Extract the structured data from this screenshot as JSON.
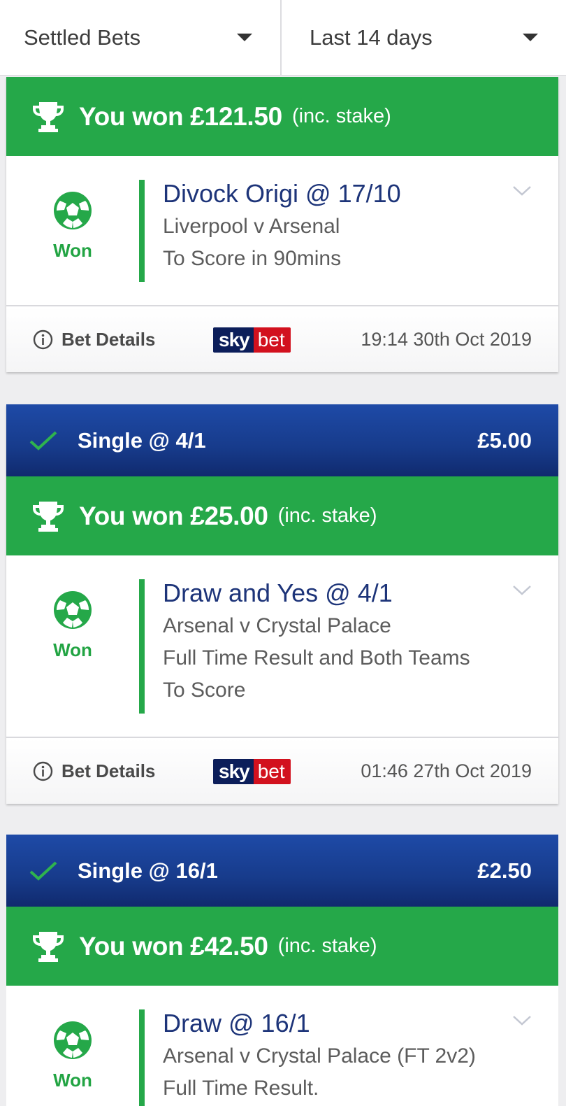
{
  "filters": {
    "status": "Settled Bets",
    "period": "Last 14 days"
  },
  "cards": [
    {
      "bet_type": "",
      "stake": "",
      "win_amount": "You won £121.50",
      "win_note": "(inc. stake)",
      "status": "Won",
      "selection": "Divock Origi @ 17/10",
      "event": "Liverpool v Arsenal",
      "market_lines": [
        "To Score in 90mins"
      ],
      "details_label": "Bet Details",
      "logo_sky": "sky",
      "logo_bet": "bet",
      "timestamp": "19:14 30th Oct 2019"
    },
    {
      "bet_type": "Single @ 4/1",
      "stake": "£5.00",
      "win_amount": "You won £25.00",
      "win_note": "(inc. stake)",
      "status": "Won",
      "selection": "Draw and Yes @ 4/1",
      "event": "Arsenal v Crystal Palace",
      "market_lines": [
        "Full Time Result and Both Teams",
        "To Score"
      ],
      "details_label": "Bet Details",
      "logo_sky": "sky",
      "logo_bet": "bet",
      "timestamp": "01:46 27th Oct 2019"
    },
    {
      "bet_type": "Single @ 16/1",
      "stake": "£2.50",
      "win_amount": "You won £42.50",
      "win_note": "(inc. stake)",
      "status": "Won",
      "selection": "Draw @ 16/1",
      "event": "Arsenal v Crystal Palace (FT 2v2)",
      "market_lines": [
        "Full Time Result."
      ],
      "details_label": "",
      "logo_sky": "",
      "logo_bet": "",
      "timestamp": ""
    }
  ],
  "colors": {
    "win_green": "#25a849",
    "header_blue": "#173b8b",
    "selection_navy": "#1d3479",
    "skybet_red": "#d2111e"
  },
  "icons": [
    "caret-down-icon",
    "check-icon",
    "trophy-icon",
    "football-icon",
    "chevron-down-icon",
    "info-icon"
  ]
}
